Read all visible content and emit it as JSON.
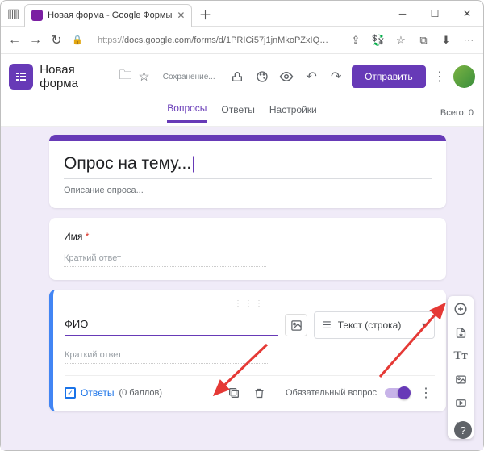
{
  "browser": {
    "tab_title": "Новая форма - Google Формы",
    "url_proto": "https://",
    "url_rest": "docs.google.com/forms/d/1PRICi57j1jnMkoPZxIQDK5SZBJEQR8TO..."
  },
  "appbar": {
    "title": "Новая форма",
    "saving": "Сохранение...",
    "send": "Отправить"
  },
  "tabs": {
    "questions": "Вопросы",
    "responses": "Ответы",
    "settings": "Настройки",
    "total": "Всего: 0"
  },
  "form": {
    "title": "Опрос на тему...",
    "desc": "Описание опроса..."
  },
  "q1": {
    "title": "Имя",
    "placeholder": "Краткий ответ"
  },
  "q2": {
    "title": "ФИО",
    "type": "Текст (строка)",
    "placeholder": "Краткий ответ",
    "answers": "Ответы",
    "points": "(0 баллов)",
    "required": "Обязательный вопрос"
  }
}
